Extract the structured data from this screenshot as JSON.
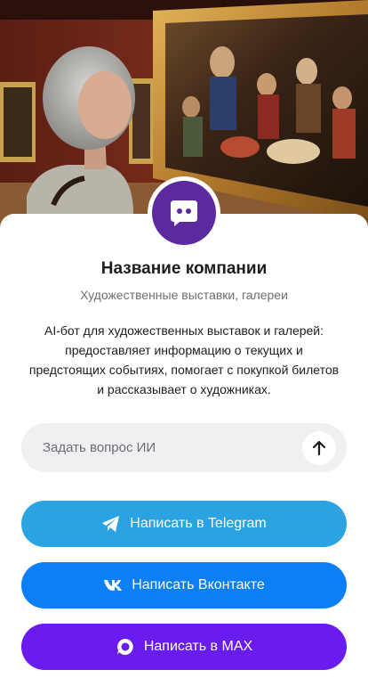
{
  "company": {
    "name": "Название компании",
    "category": "Художественные выставки, галереи",
    "description": "AI-бот для художественных выставок и галерей: предоставляет информацию о текущих и предстоящих событиях, помогает с покупкой билетов и рассказывает о художниках."
  },
  "ask": {
    "placeholder": "Задать вопрос ИИ",
    "send_icon": "arrow-up-icon"
  },
  "actions": [
    {
      "label": "Написать в Telegram",
      "icon": "telegram-icon",
      "color": "#2aa3e0"
    },
    {
      "label": "Написать Вконтакте",
      "icon": "vk-icon",
      "color": "#0b7ff5"
    },
    {
      "label": "Написать в MAX",
      "icon": "max-icon",
      "color": "#6a1bf0"
    }
  ],
  "colors": {
    "logo_bg": "#5b2a9e",
    "input_bg": "#f0f0f2"
  }
}
